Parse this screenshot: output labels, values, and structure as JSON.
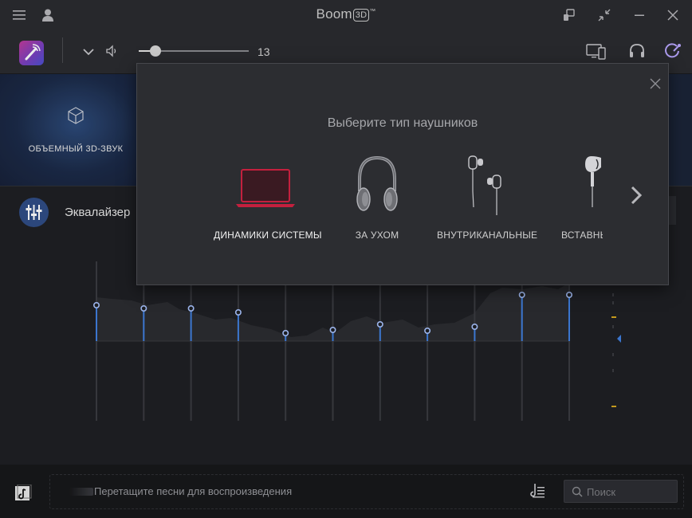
{
  "window": {
    "title": "Boom",
    "title_badge": "3D",
    "title_tm": "™"
  },
  "toolbar": {
    "volume_value": "13",
    "volume_fraction": 0.15
  },
  "effect": {
    "label": "ОБЪЕМНЫЙ 3D-ЗВУК"
  },
  "equalizer": {
    "label": "Эквалайзер",
    "band_levels": [
      0.45,
      0.41,
      0.41,
      0.36,
      0.1,
      0.14,
      0.21,
      0.13,
      0.18,
      0.58,
      0.58
    ]
  },
  "headphone_dialog": {
    "title": "Выберите тип наушников",
    "options": [
      {
        "label": "ДИНАМИКИ СИСТЕМЫ",
        "selected": true
      },
      {
        "label": "ЗА УХОМ",
        "selected": false
      },
      {
        "label": "ВНУТРИКАНАЛЬНЫЕ",
        "selected": false
      },
      {
        "label": "ВСТАВНЫ",
        "selected": false
      }
    ]
  },
  "player": {
    "dropzone_text": "Перетащите песни для воспроизведения",
    "search_placeholder": "Поиск"
  },
  "colors": {
    "accent": "#3f7fe0",
    "selected_speaker": "#c4203e",
    "eq_marker": "#d4a61f"
  }
}
